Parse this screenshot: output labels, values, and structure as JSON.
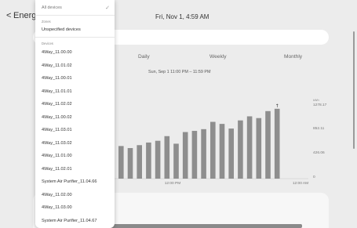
{
  "header": {
    "back_glyph": "<",
    "title": "Energ",
    "datetime": "Fri, Nov 1, 4:59 AM"
  },
  "tabs": [
    "Daily",
    "Weekly",
    "Monthly"
  ],
  "range_label": "Sun, Sep 1 11:00 PM – 11:59 PM",
  "chart_data": {
    "type": "bar",
    "title": "",
    "xlabel": "",
    "ylabel": "",
    "y_unit": "kWh",
    "y_ticks": [
      "1278.17",
      "852.11",
      "426.06",
      "0"
    ],
    "ylim": [
      0,
      1278.17
    ],
    "x_tick_labels": [
      "12:00 PM",
      "12:00 AM"
    ],
    "values": [
      560,
      525,
      575,
      620,
      650,
      730,
      600,
      800,
      820,
      850,
      975,
      940,
      860,
      1000,
      1070,
      1040,
      1160,
      1200
    ],
    "bar_color": "#8e8e8e",
    "marker": "↑"
  },
  "dropdown": {
    "header": "All devices",
    "check_icon": "check-icon",
    "zones_label": "Zones",
    "zone_items": [
      "Unspecified devices"
    ],
    "devices_label": "Devices",
    "device_items": [
      "4Way_11.00.00",
      "4Way_11.01.02",
      "4Way_11.00.01",
      "4Way_11.01.01",
      "4Way_11.02.02",
      "4Way_11.00.02",
      "4Way_11.03.01",
      "4Way_11.03.02",
      "4Way_11.01.00",
      "4Way_11.02.01",
      "System Air Purifier_11.04.66",
      "4Way_11.02.00",
      "4Way_11.03.00",
      "System Air Purifier_11.04.67"
    ]
  }
}
